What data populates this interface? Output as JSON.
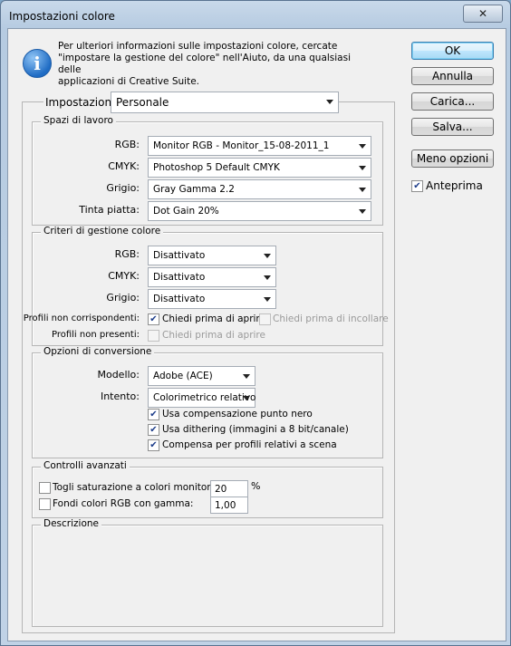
{
  "window": {
    "title": "Impostazioni colore",
    "close_glyph": "✕"
  },
  "info": {
    "icon": "info-icon",
    "line1": "Per ulteriori informazioni sulle impostazioni colore, cercate",
    "line2": "\"impostare la gestione del colore\" nell'Aiuto, da una qualsiasi delle",
    "line3": "applicazioni di Creative Suite."
  },
  "buttons": {
    "ok": "OK",
    "cancel": "Annulla",
    "load": "Carica...",
    "save": "Salva...",
    "fewer": "Meno opzioni"
  },
  "preview": {
    "label": "Anteprima",
    "checked": true
  },
  "settings": {
    "label": "Impostazioni:",
    "value": "Personale"
  },
  "workspaces": {
    "legend": "Spazi di lavoro",
    "rgb_label": "RGB:",
    "rgb_value": "Monitor RGB - Monitor_15-08-2011_1",
    "cmyk_label": "CMYK:",
    "cmyk_value": "Photoshop 5 Default CMYK",
    "gray_label": "Grigio:",
    "gray_value": "Gray Gamma 2.2",
    "spot_label": "Tinta piatta:",
    "spot_value": "Dot Gain 20%"
  },
  "policies": {
    "legend": "Criteri di gestione colore",
    "rgb_label": "RGB:",
    "rgb_value": "Disattivato",
    "cmyk_label": "CMYK:",
    "cmyk_value": "Disattivato",
    "gray_label": "Grigio:",
    "gray_value": "Disattivato",
    "mismatch_label": "Profili non corrispondenti:",
    "ask_open": "Chiedi prima di aprire",
    "ask_paste": "Chiedi prima di incollare",
    "missing_label": "Profili non presenti:",
    "missing_ask_open": "Chiedi prima di aprire"
  },
  "conversion": {
    "legend": "Opzioni di conversione",
    "engine_label": "Modello:",
    "engine_value": "Adobe (ACE)",
    "intent_label": "Intento:",
    "intent_value": "Colorimetrico relativo",
    "bpc": "Usa compensazione punto nero",
    "dither": "Usa dithering (immagini a 8 bit/canale)",
    "compensate": "Compensa per profili relativi a scena"
  },
  "advanced": {
    "legend": "Controlli avanzati",
    "desaturate": "Togli saturazione a colori monitor di:",
    "desaturate_value": "20",
    "desaturate_unit": "%",
    "blend": "Fondi colori RGB con gamma:",
    "blend_value": "1,00"
  },
  "description": {
    "legend": "Descrizione"
  }
}
